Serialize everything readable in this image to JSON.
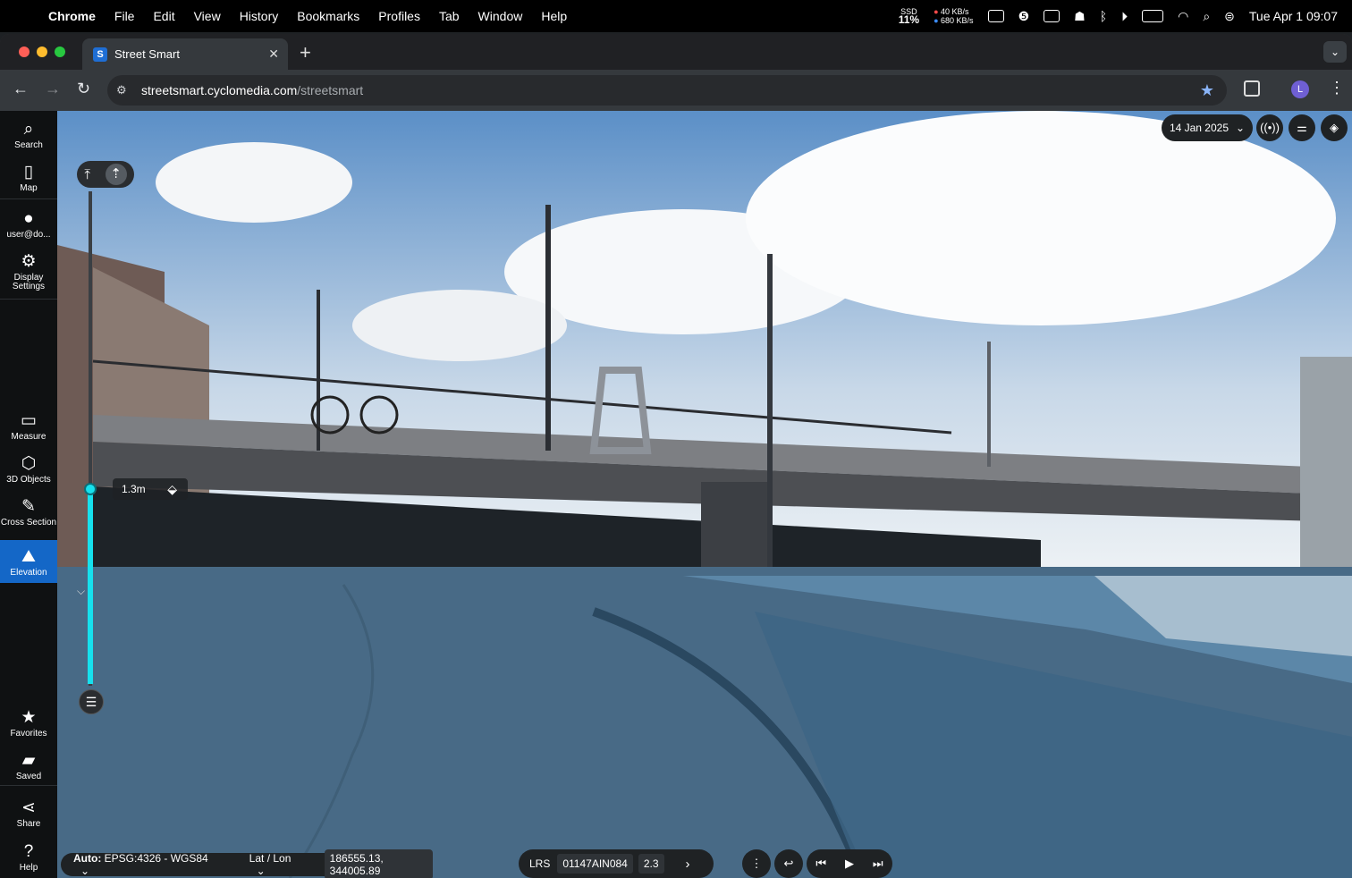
{
  "menubar": {
    "app": "Chrome",
    "items": [
      "File",
      "Edit",
      "View",
      "History",
      "Bookmarks",
      "Profiles",
      "Tab",
      "Window",
      "Help"
    ],
    "ssd_label": "SSD",
    "ssd_value": "11%",
    "net_up": "40 KB/s",
    "net_down": "680 KB/s",
    "datetime": "Tue Apr 1  09:07"
  },
  "browser": {
    "tab_title": "Street Smart",
    "tab_favicon": "S",
    "url_host": "streetsmart.cyclomedia.com",
    "url_path": "/streetsmart",
    "profile_initial": "L"
  },
  "sidebar": {
    "search": "Search",
    "map": "Map",
    "user": "user@do...",
    "display_settings": "Display Settings",
    "measure": "Measure",
    "objects_3d": "3D Objects",
    "cross_section": "Cross Section",
    "elevation": "Elevation",
    "favorites": "Favorites",
    "saved": "Saved",
    "share": "Share",
    "help": "Help"
  },
  "viewer": {
    "date": "14 Jan 2025",
    "elevation_value": "1.3m",
    "elevation_level": 0.6
  },
  "coords": {
    "crs_prefix": "Auto:",
    "crs": "EPSG:4326 - WGS84",
    "format": "Lat / Lon",
    "value": "186555.13, 344005.89"
  },
  "lrs": {
    "label": "LRS",
    "id": "01147AIN084",
    "measure": "2.3"
  },
  "colors": {
    "accent": "#1467c7",
    "elevation": "#16e1ee",
    "water_overlay": "#2f6a95"
  }
}
